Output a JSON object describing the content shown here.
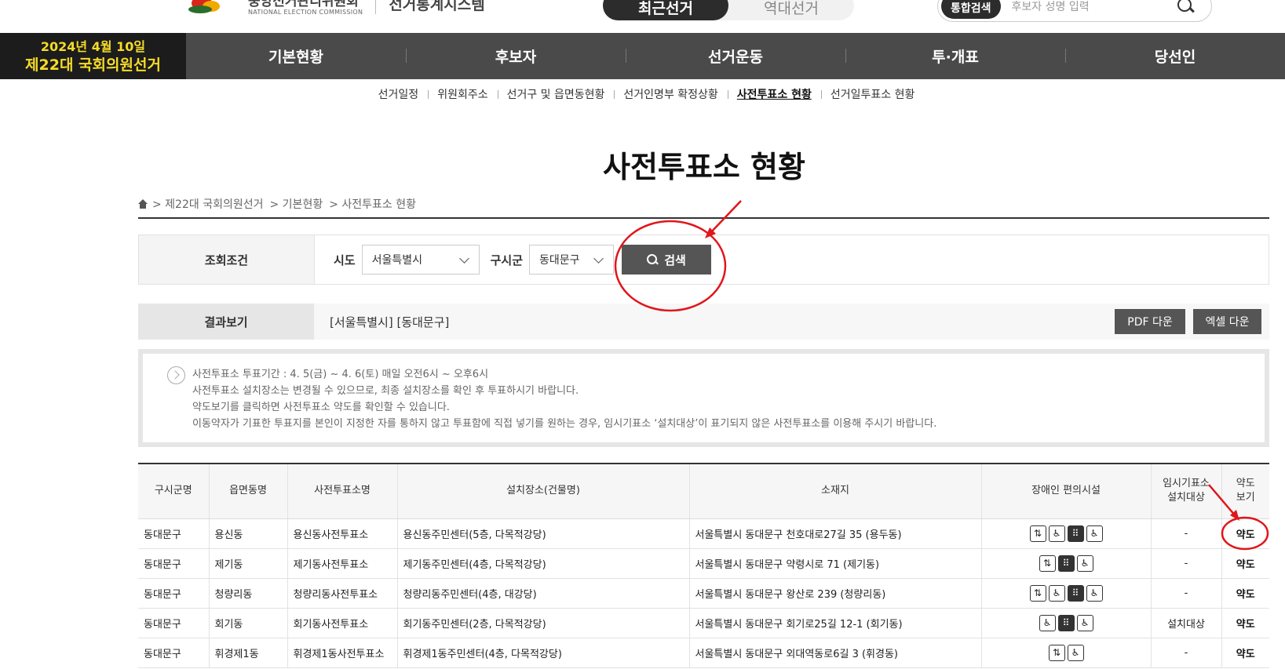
{
  "header": {
    "logo_kor": "중앙선거관리위원회",
    "logo_eng": "NATIONAL ELECTION COMMISSION",
    "system_title": "선거통계시스템",
    "tabs": [
      {
        "label": "최근선거",
        "active": true
      },
      {
        "label": "역대선거",
        "active": false
      }
    ],
    "search": {
      "tag": "통합검색",
      "placeholder": "후보자 성명 입력"
    }
  },
  "election": {
    "date": "2024년 4월 10일",
    "name": "제22대 국회의원선거"
  },
  "main_nav": [
    "기본현황",
    "후보자",
    "선거운동",
    "투·개표",
    "당선인"
  ],
  "sub_nav": [
    {
      "label": "선거일정",
      "active": false
    },
    {
      "label": "위원회주소",
      "active": false
    },
    {
      "label": "선거구 및 읍면동현황",
      "active": false
    },
    {
      "label": "선거인명부 확정상황",
      "active": false
    },
    {
      "label": "사전투표소 현황",
      "active": true
    },
    {
      "label": "선거일투표소 현황",
      "active": false
    }
  ],
  "page_title": "사전투표소 현황",
  "breadcrumb": [
    "> 제22대 국회의원선거",
    "> 기본현황",
    "> 사전투표소 현황"
  ],
  "condition": {
    "label": "조회조건",
    "sido_label": "시도",
    "sido_value": "서울특별시",
    "gusigun_label": "구시군",
    "gusigun_value": "동대문구",
    "search_button": "검색"
  },
  "result": {
    "label": "결과보기",
    "text": "[서울특별시] [동대문구]",
    "pdf_button": "PDF 다운",
    "excel_button": "엑셀 다운"
  },
  "notice": [
    "사전투표소 투표기간 : 4. 5(금) ~ 4. 6(토) 매일 오전6시 ~ 오후6시",
    "사전투표소 설치장소는 변경될 수 있으므로, 최종 설치장소를 확인 후 투표하시기 바랍니다.",
    "약도보기를 클릭하면 사전투표소 약도를 확인할 수 있습니다.",
    "이동약자가 기표한 투표지를 본인이 지정한 자를 통하지 않고 투표함에 직접 넣기를 원하는 경우, 임시기표소 ‘설치대상’이 표기되지 않은 사전투표소를 이용해 주시기 바랍니다."
  ],
  "table": {
    "headers": [
      "구시군명",
      "읍면동명",
      "사전투표소명",
      "설치장소(건물명)",
      "소재지",
      "장애인 편의시설",
      "임시기표소\n설치대상",
      "약도\n보기"
    ],
    "header_lines": {
      "temp_booth": [
        "임시기표소",
        "설치대상"
      ],
      "map": [
        "약도",
        "보기"
      ]
    },
    "rows": [
      {
        "gu": "동대문구",
        "dong": "용신동",
        "name": "용신동사전투표소",
        "place": "용신동주민센터(5층, 다목적강당)",
        "addr": "서울특별시 동대문구 천호대로27길 35 (용두동)",
        "facilities": [
          "elevator-icon",
          "wheelchair-slope-icon",
          "braille-icon",
          "accessible-icon"
        ],
        "temp": "-",
        "map": "약도"
      },
      {
        "gu": "동대문구",
        "dong": "제기동",
        "name": "제기동사전투표소",
        "place": "제기동주민센터(4층, 다목적강당)",
        "addr": "서울특별시 동대문구 약령시로 71 (제기동)",
        "facilities": [
          "elevator-icon",
          "braille-icon",
          "accessible-icon"
        ],
        "temp": "-",
        "map": "약도"
      },
      {
        "gu": "동대문구",
        "dong": "청량리동",
        "name": "청량리동사전투표소",
        "place": "청량리동주민센터(4층, 대강당)",
        "addr": "서울특별시 동대문구 왕산로 239 (청량리동)",
        "facilities": [
          "elevator-icon",
          "wheelchair-slope-icon",
          "braille-icon",
          "accessible-icon"
        ],
        "temp": "-",
        "map": "약도"
      },
      {
        "gu": "동대문구",
        "dong": "회기동",
        "name": "회기동사전투표소",
        "place": "회기동주민센터(2층, 다목적강당)",
        "addr": "서울특별시 동대문구 회기로25길 12-1 (회기동)",
        "facilities": [
          "wheelchair-slope-icon",
          "braille-icon",
          "accessible-icon"
        ],
        "temp": "설치대상",
        "map": "약도"
      },
      {
        "gu": "동대문구",
        "dong": "휘경제1동",
        "name": "휘경제1동사전투표소",
        "place": "휘경제1동주민센터(4층, 다목적강당)",
        "addr": "서울특별시 동대문구 외대역동로6길 3 (휘경동)",
        "facilities": [
          "elevator-icon",
          "accessible-icon"
        ],
        "temp": "-",
        "map": "약도"
      }
    ]
  },
  "colors": {
    "nav_bg": "#4a4a4a",
    "badge_bg": "#1c1c1c",
    "badge_text": "#f5dc28",
    "annotation_red": "#e0161b"
  }
}
